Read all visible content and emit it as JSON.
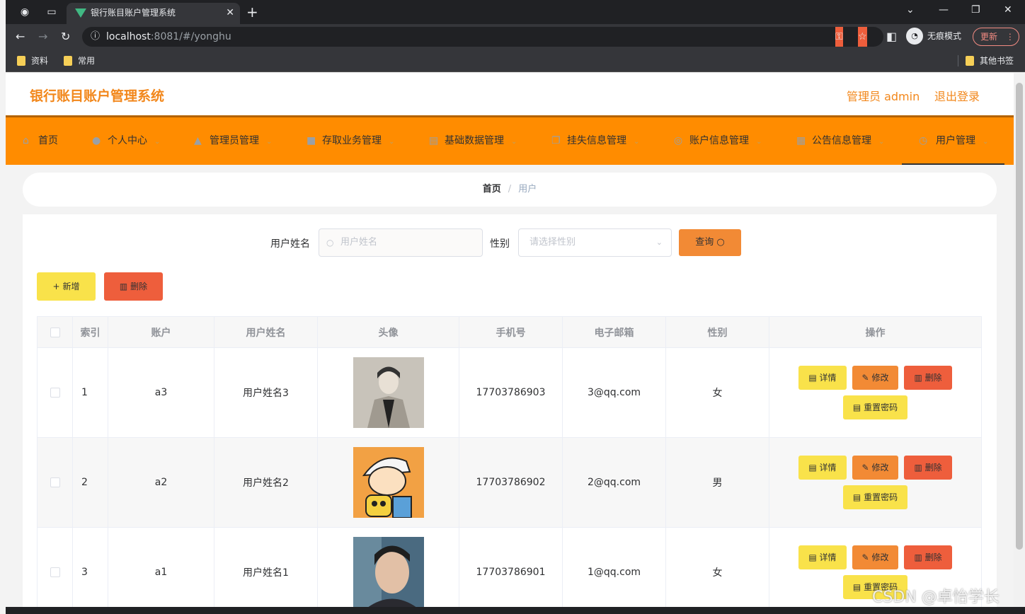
{
  "browser": {
    "tab_title": "银行账目账户管理系统",
    "url_host": "localhost",
    "url_path": ":8081/#/yonghu",
    "incognito_label": "无痕模式",
    "update_label": "更新",
    "bookmarks": [
      "资料",
      "常用"
    ],
    "other_bookmarks": "其他书签"
  },
  "header": {
    "title": "银行账目账户管理系统",
    "admin": "管理员 admin",
    "logout": "退出登录"
  },
  "menu": [
    {
      "label": "首页",
      "icon": "home-icon"
    },
    {
      "label": "个人中心",
      "icon": "user-icon"
    },
    {
      "label": "管理员管理",
      "icon": "admin-icon"
    },
    {
      "label": "存取业务管理",
      "icon": "video-icon"
    },
    {
      "label": "基础数据管理",
      "icon": "clipboard-icon"
    },
    {
      "label": "挂失信息管理",
      "icon": "copy-icon"
    },
    {
      "label": "账户信息管理",
      "icon": "target-icon"
    },
    {
      "label": "公告信息管理",
      "icon": "grid-icon"
    },
    {
      "label": "用户管理",
      "icon": "compass-icon"
    }
  ],
  "breadcrumb": {
    "home": "首页",
    "current": "用户"
  },
  "search": {
    "name_label": "用户姓名",
    "name_placeholder": "用户姓名",
    "gender_label": "性别",
    "gender_placeholder": "请选择性别",
    "query_button": "查询"
  },
  "actions": {
    "add": "新增",
    "delete": "删除"
  },
  "table": {
    "columns": [
      "索引",
      "账户",
      "用户姓名",
      "头像",
      "手机号",
      "电子邮箱",
      "性别",
      "操作"
    ],
    "rows": [
      {
        "index": "1",
        "account": "a3",
        "name": "用户姓名3",
        "phone": "17703786903",
        "email": "3@qq.com",
        "gender": "女"
      },
      {
        "index": "2",
        "account": "a2",
        "name": "用户姓名2",
        "phone": "17703786902",
        "email": "2@qq.com",
        "gender": "男"
      },
      {
        "index": "3",
        "account": "a1",
        "name": "用户姓名1",
        "phone": "17703786901",
        "email": "1@qq.com",
        "gender": "女"
      }
    ],
    "op_labels": {
      "detail": "详情",
      "edit": "修改",
      "delete": "删除",
      "reset": "重置密码"
    }
  },
  "watermark": "CSDN @卓怡学长",
  "colors": {
    "accent": "#ff8c00",
    "brand_text": "#f2871b",
    "yellow": "#f9e24a",
    "orange": "#f28a35",
    "red": "#ee5e3c"
  }
}
